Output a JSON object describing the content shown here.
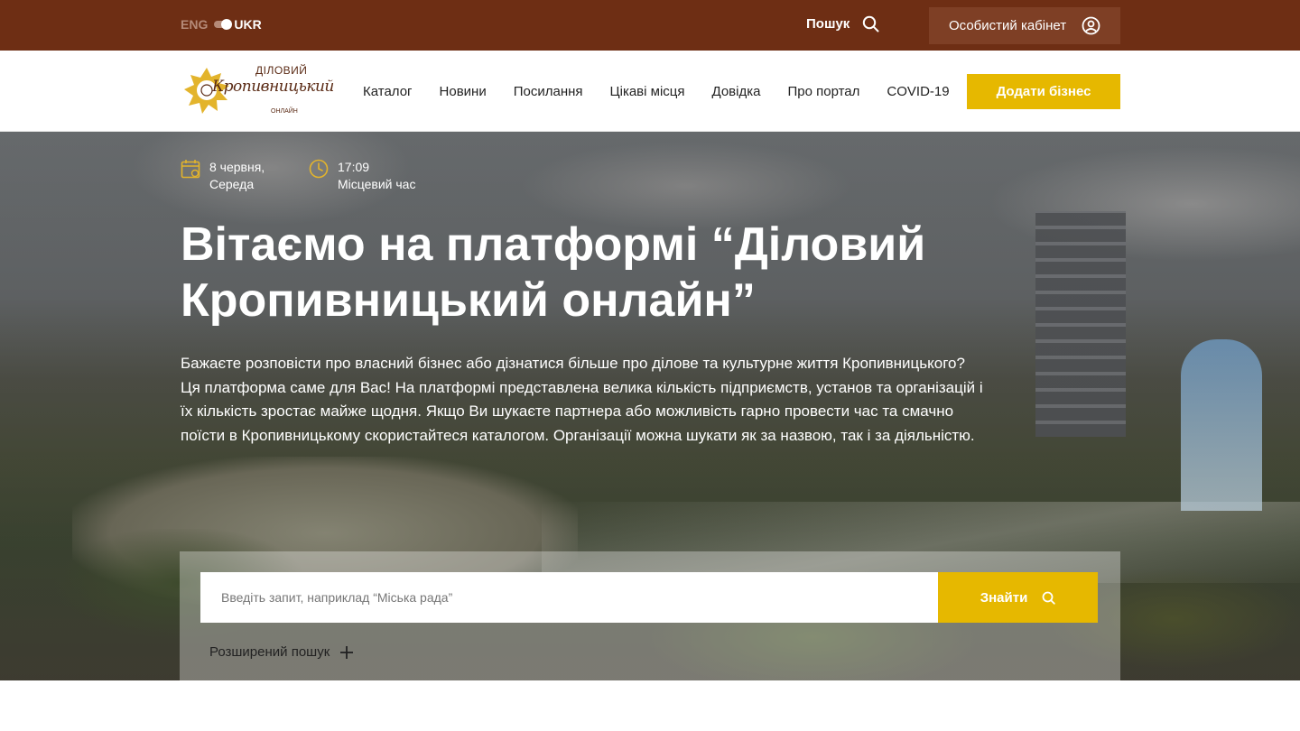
{
  "topbar": {
    "lang_eng": "ENG",
    "lang_ukr": "UKR",
    "search_label": "Пошук",
    "cabinet_label": "Особистий кабінет"
  },
  "logo": {
    "line1": "ДІЛОВИЙ",
    "line2": "Кропивницький",
    "line3": "ОНЛАЙН"
  },
  "nav": {
    "items": [
      {
        "label": "Каталог"
      },
      {
        "label": "Новини"
      },
      {
        "label": "Посилання"
      },
      {
        "label": "Цікаві місця"
      },
      {
        "label": "Довідка"
      },
      {
        "label": "Про портал"
      },
      {
        "label": "COVID-19"
      }
    ],
    "add_business_label": "Додати бізнес"
  },
  "hero": {
    "date_line1": "8 червня,",
    "date_line2": "Середа",
    "time_line1": "17:09",
    "time_line2": "Місцевий час",
    "title": "Вітаємо на платформі “Діловий Кропивницький онлайн”",
    "intro": "Бажаєте розповісти про власний бізнес або дізнатися більше про ділове та культурне життя Кропивницького? Ця платформа саме для Вас! На платформі представлена велика кількість підприємств, установ та організацій і їх кількість зростає майже щодня. Якщо Ви шукаєте партнера або можливість гарно провести час та смачно поїсти в Кропивницькому скористайтеся каталогом. Організації можна шукати як за назвою, так і за діяльністю."
  },
  "search": {
    "placeholder": "Введіть запит, наприклад “Міська рада”",
    "value": "",
    "button_label": "Знайти",
    "advanced_label": "Розширений пошук",
    "advanced_icon": "plus-icon"
  },
  "colors": {
    "topbar_bg": "#6e2e14",
    "cabinet_bg": "#7e3f25",
    "accent_yellow": "#e6b800",
    "icon_yellow": "#e3b42c",
    "brand_brown": "#5a2a14"
  },
  "icons": {
    "search": "search-icon",
    "user": "user-icon",
    "calendar": "calendar-icon",
    "clock": "clock-icon"
  }
}
